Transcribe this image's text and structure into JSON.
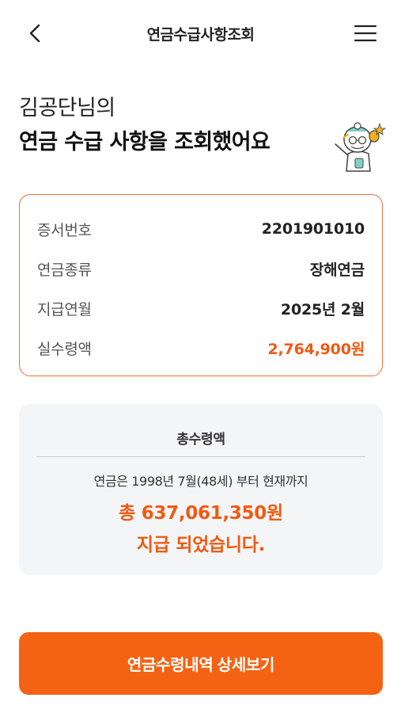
{
  "header": {
    "title": "연금수급사항조회",
    "back_icon": "chevron-left-icon",
    "menu_icon": "hamburger-menu-icon"
  },
  "greeting": {
    "line1": "김공단님의",
    "line2": "연금 수급 사항을 조회했어요"
  },
  "info": {
    "rows": [
      {
        "label": "증서번호",
        "value": "2201901010"
      },
      {
        "label": "연금종류",
        "value": "장해연금"
      },
      {
        "label": "지급연월",
        "value": "2025년 2월"
      },
      {
        "label": "실수령액",
        "value": "2,764,900원"
      }
    ]
  },
  "total": {
    "title": "총수령액",
    "description": "연금은 1998년 7월(48세) 부터 현재까지",
    "amount": "총 637,061,350원",
    "suffix": "지급 되었습니다."
  },
  "cta": {
    "label": "연금수령내역 상세보기"
  },
  "colors": {
    "accent": "#f46314",
    "accent_text": "#f05a12",
    "card_border": "#f0703a",
    "total_bg": "#f4f5f7"
  }
}
